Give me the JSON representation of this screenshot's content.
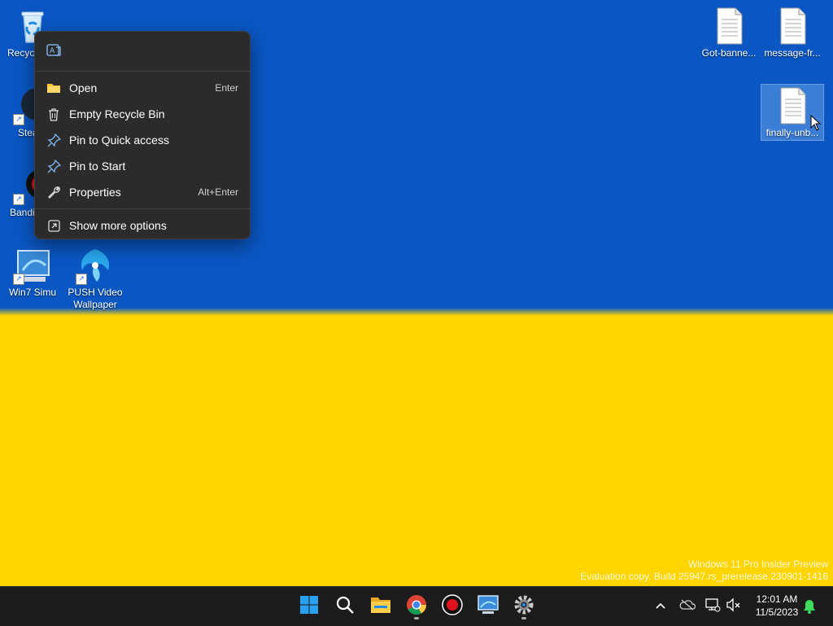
{
  "desktop": {
    "icons": [
      {
        "name": "recycle-bin",
        "label": "Recycle Bin",
        "icon": "recycle-bin-icon"
      },
      {
        "name": "steam",
        "label": "Steam",
        "icon": "steam-icon"
      },
      {
        "name": "bandicam",
        "label": "Bandicam",
        "icon": "bandicam-icon"
      },
      {
        "name": "win7-simu",
        "label": "Win7 Simu",
        "icon": "win7-simu-icon"
      },
      {
        "name": "push-video-wallpaper",
        "label": "PUSH Video Wallpaper",
        "icon": "push-video-wallpaper-icon"
      },
      {
        "name": "got-banned",
        "label": "Got-banne...",
        "icon": "text-file-icon"
      },
      {
        "name": "message-fr",
        "label": "message-fr...",
        "icon": "text-file-icon"
      },
      {
        "name": "finally-unb",
        "label": "finally-unb...",
        "icon": "text-file-icon"
      }
    ],
    "partial_labels": {
      "recycle": "Recyc",
      "steam": "Stea",
      "bandicam": "Bandi"
    }
  },
  "context_menu": {
    "top_icon": "ai-translate-icon",
    "items": [
      {
        "label": "Open",
        "shortcut": "Enter",
        "icon": "folder-icon"
      },
      {
        "label": "Empty Recycle Bin",
        "shortcut": "",
        "icon": "trash-icon"
      },
      {
        "label": "Pin to Quick access",
        "shortcut": "",
        "icon": "pin-icon"
      },
      {
        "label": "Pin to Start",
        "shortcut": "",
        "icon": "pin-icon"
      },
      {
        "label": "Properties",
        "shortcut": "Alt+Enter",
        "icon": "wrench-icon"
      },
      {
        "label": "Show more options",
        "shortcut": "",
        "icon": "show-more-icon"
      }
    ]
  },
  "watermark": {
    "line1": "Windows 11 Pro Insider Preview",
    "line2": "Evaluation copy. Build 25947.rs_prerelease.230901-1416"
  },
  "taskbar": {
    "apps": [
      "start-icon",
      "search-icon",
      "file-explorer-icon",
      "chrome-icon",
      "record-icon",
      "win7-simu-icon",
      "settings-icon"
    ],
    "tray": [
      "chevron-up-icon",
      "onedrive-icon",
      "network-icon",
      "volume-muted-icon"
    ],
    "time": "12:01 AM",
    "date": "11/5/2023"
  },
  "colors": {
    "wallpaper_top": "#0a57c4",
    "wallpaper_bottom": "#ffd500",
    "menu_bg": "#2b2b2b",
    "taskbar_bg": "#1c1c1c"
  }
}
